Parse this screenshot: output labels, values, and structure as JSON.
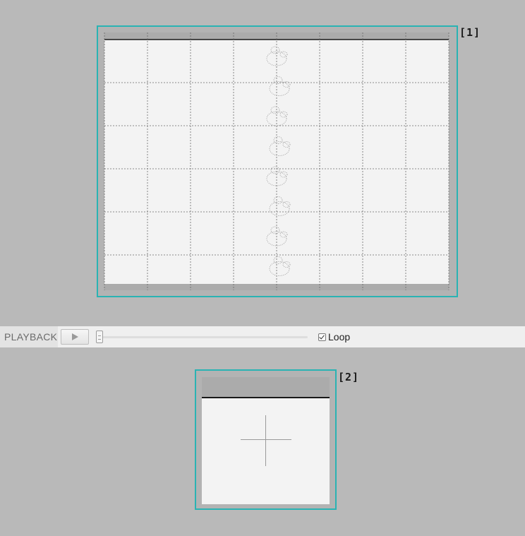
{
  "panels": {
    "sheet_label": "[1]",
    "preview_label": "[2]"
  },
  "sprite_sheet": {
    "columns": 8,
    "rows": 6,
    "sprite_count": 8
  },
  "playback": {
    "label": "PLAYBACK",
    "play_icon": "play-icon",
    "frame_position": 0,
    "loop_label": "Loop",
    "loop_checked": true
  },
  "colors": {
    "accent_border": "#2ab3b3",
    "background": "#b9b9b9",
    "canvas": "#f3f3f3"
  }
}
